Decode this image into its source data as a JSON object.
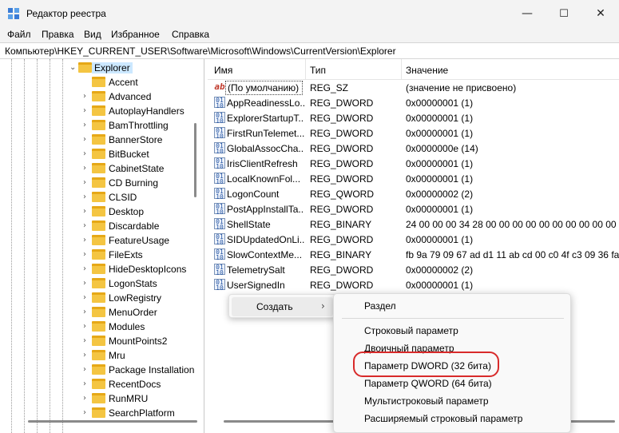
{
  "window": {
    "title": "Редактор реестра",
    "minimize": "—",
    "maximize": "☐",
    "close": "✕"
  },
  "menu": [
    "Файл",
    "Правка",
    "Вид",
    "Избранное",
    "Справка"
  ],
  "address": "Компьютер\\HKEY_CURRENT_USER\\Software\\Microsoft\\Windows\\CurrentVersion\\Explorer",
  "tree": {
    "selected": "Explorer",
    "children": [
      "Accent",
      "Advanced",
      "AutoplayHandlers",
      "BamThrottling",
      "BannerStore",
      "BitBucket",
      "CabinetState",
      "CD Burning",
      "CLSID",
      "Desktop",
      "Discardable",
      "FeatureUsage",
      "FileExts",
      "HideDesktopIcons",
      "LogonStats",
      "LowRegistry",
      "MenuOrder",
      "Modules",
      "MountPoints2",
      "Mru",
      "Package Installation",
      "RecentDocs",
      "RunMRU",
      "SearchPlatform"
    ]
  },
  "list": {
    "headers": {
      "name": "Имя",
      "type": "Тип",
      "data": "Значение"
    },
    "rows": [
      {
        "name": "(По умолчанию)",
        "type": "REG_SZ",
        "data": "(значение не присвоено)",
        "icon": "string-value-icon"
      },
      {
        "name": "AppReadinessLo...",
        "type": "REG_DWORD",
        "data": "0x00000001 (1)",
        "icon": "binary-value-icon"
      },
      {
        "name": "ExplorerStartupT...",
        "type": "REG_DWORD",
        "data": "0x00000001 (1)",
        "icon": "binary-value-icon"
      },
      {
        "name": "FirstRunTelemet...",
        "type": "REG_DWORD",
        "data": "0x00000001 (1)",
        "icon": "binary-value-icon"
      },
      {
        "name": "GlobalAssocCha...",
        "type": "REG_DWORD",
        "data": "0x0000000e (14)",
        "icon": "binary-value-icon"
      },
      {
        "name": "IrisClientRefresh",
        "type": "REG_DWORD",
        "data": "0x00000001 (1)",
        "icon": "binary-value-icon"
      },
      {
        "name": "LocalKnownFol...",
        "type": "REG_DWORD",
        "data": "0x00000001 (1)",
        "icon": "binary-value-icon"
      },
      {
        "name": "LogonCount",
        "type": "REG_QWORD",
        "data": "0x00000002 (2)",
        "icon": "binary-value-icon"
      },
      {
        "name": "PostAppInstallTa...",
        "type": "REG_DWORD",
        "data": "0x00000001 (1)",
        "icon": "binary-value-icon"
      },
      {
        "name": "ShellState",
        "type": "REG_BINARY",
        "data": "24 00 00 00 34 28 00 00 00 00 00 00 00 00 00 00 00 00",
        "icon": "binary-value-icon"
      },
      {
        "name": "SIDUpdatedOnLi...",
        "type": "REG_DWORD",
        "data": "0x00000001 (1)",
        "icon": "binary-value-icon"
      },
      {
        "name": "SlowContextMe...",
        "type": "REG_BINARY",
        "data": "fb 9a 79 09 67 ad d1 11 ab cd 00 c0 4f c3 09 36 fa 00",
        "icon": "binary-value-icon"
      },
      {
        "name": "TelemetrySalt",
        "type": "REG_DWORD",
        "data": "0x00000002 (2)",
        "icon": "binary-value-icon"
      },
      {
        "name": "UserSignedIn",
        "type": "REG_DWORD",
        "data": "0x00000001 (1)",
        "icon": "binary-value-icon"
      }
    ]
  },
  "context_menu": {
    "create_label": "Создать",
    "arrow": "›",
    "submenu": {
      "key": "Раздел",
      "items": [
        "Строковый параметр",
        "Двоичный параметр",
        "Параметр DWORD (32 бита)",
        "Параметр QWORD (64 бита)",
        "Мультистроковый параметр",
        "Расширяемый строковый параметр"
      ]
    }
  },
  "accent_colors": {
    "highlight_ring": "#d82a2a",
    "folder": "#f4c542",
    "selection": "#cce8ff"
  }
}
